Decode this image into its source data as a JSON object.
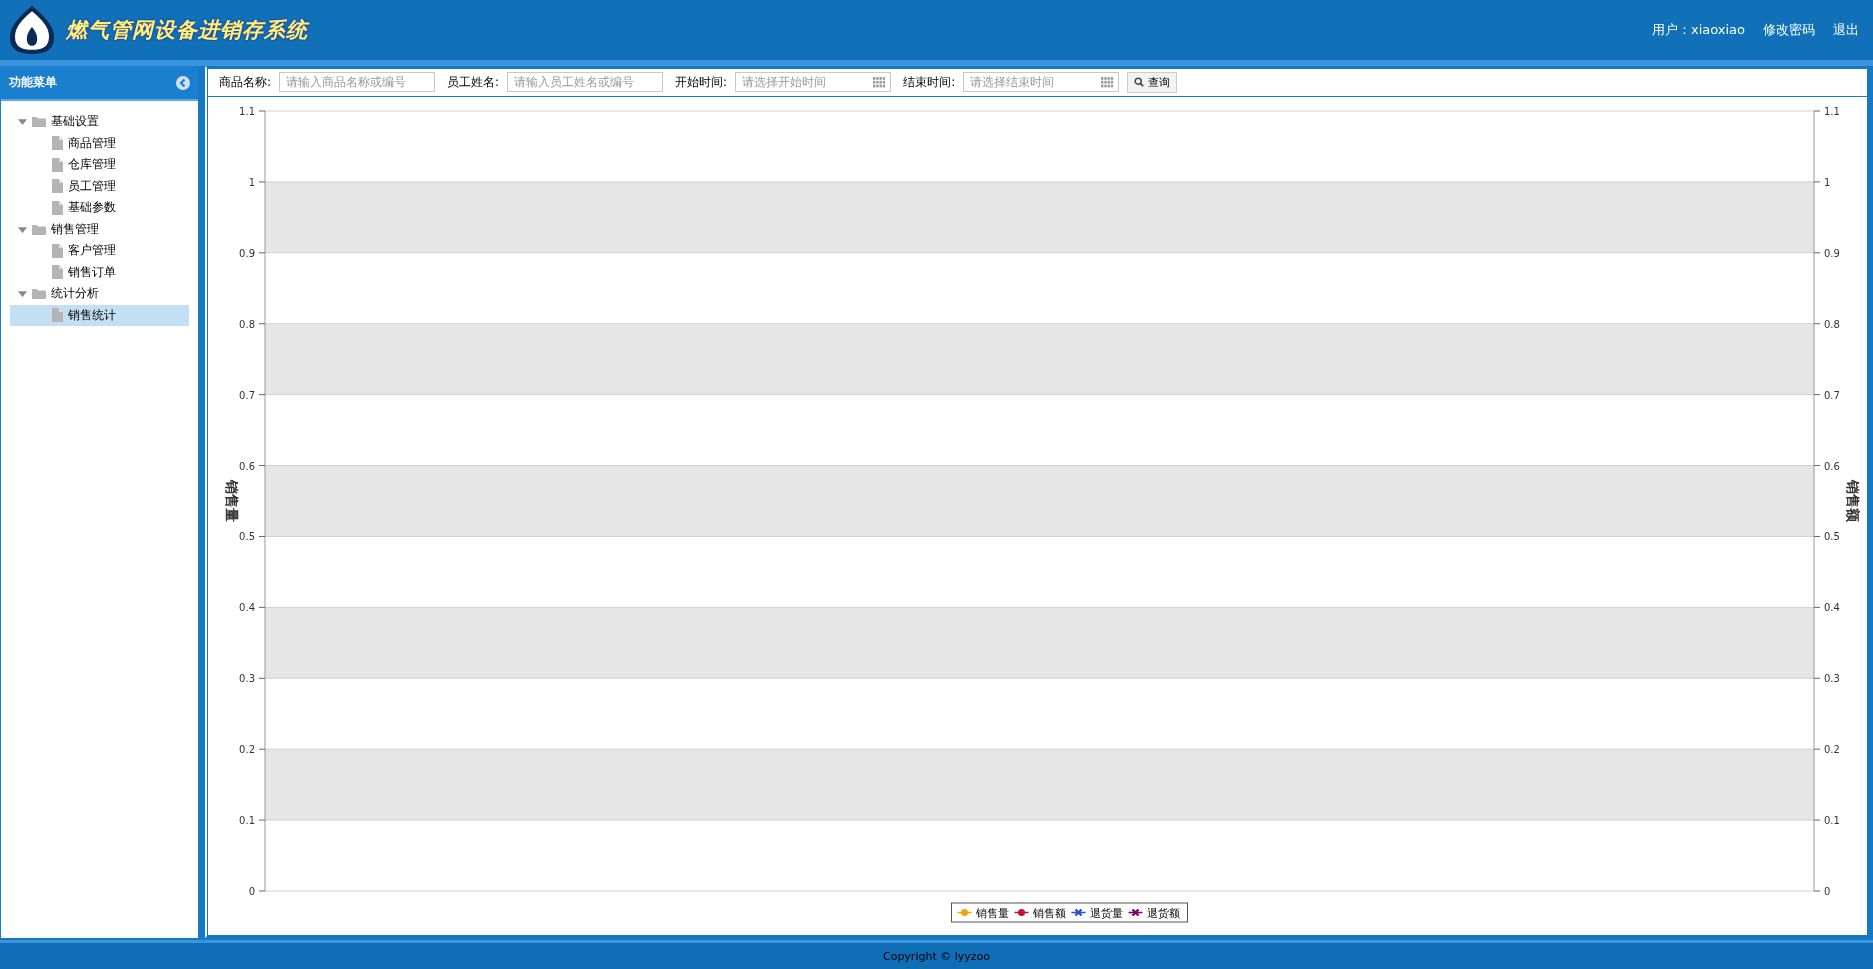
{
  "header": {
    "title": "燃气管网设备进销存系统",
    "user": "用户：xiaoxiao",
    "links": [
      "修改密码",
      "退出"
    ]
  },
  "sidebar": {
    "title": "功能菜单",
    "tree": [
      {
        "label": "基础设置",
        "expanded": true,
        "selected": false,
        "children": [
          {
            "label": "商品管理",
            "selected": false
          },
          {
            "label": "仓库管理",
            "selected": false
          },
          {
            "label": "员工管理",
            "selected": false
          },
          {
            "label": "基础参数",
            "selected": false
          }
        ]
      },
      {
        "label": "销售管理",
        "expanded": true,
        "selected": false,
        "children": [
          {
            "label": "客户管理",
            "selected": false
          },
          {
            "label": "销售订单",
            "selected": false
          }
        ]
      },
      {
        "label": "统计分析",
        "expanded": true,
        "selected": false,
        "children": [
          {
            "label": "销售统计",
            "selected": true
          }
        ]
      }
    ]
  },
  "filters": [
    {
      "kind": "text",
      "label": "商品名称:",
      "placeholder": "请输入商品名称或编号"
    },
    {
      "kind": "text",
      "label": "员工姓名:",
      "placeholder": "请输入员工姓名或编号"
    },
    {
      "kind": "date",
      "label": "开始时间:",
      "placeholder": "请选择开始时间"
    },
    {
      "kind": "date",
      "label": "结束时间:",
      "placeholder": "请选择结束时间"
    }
  ],
  "search_button": "查询",
  "right_axis": {
    "title": "销售额",
    "ticks": [
      "1.1",
      "1",
      "0.9",
      "0.8",
      "0.7",
      "0.6",
      "0.5",
      "0.4",
      "0.3",
      "0.2",
      "0.1",
      "0"
    ]
  },
  "chart_data": {
    "type": "line",
    "ylabel": "销售量",
    "grid": true,
    "ylim": [
      0,
      1.1
    ],
    "yticks": [
      0,
      0.1,
      0.2,
      0.3,
      0.4,
      0.5,
      0.6,
      0.7,
      0.8,
      0.9,
      1,
      1.1
    ],
    "series": [
      {
        "name": "销售量",
        "color": "#f0a30a",
        "marker": "circle"
      },
      {
        "name": "销售额",
        "color": "#c8102e",
        "marker": "circle"
      },
      {
        "name": "退货量",
        "color": "#2850c8",
        "marker": "cross"
      },
      {
        "name": "退货额",
        "color": "#800070",
        "marker": "cross"
      }
    ]
  },
  "footer": "Copyright © lyyzoo"
}
